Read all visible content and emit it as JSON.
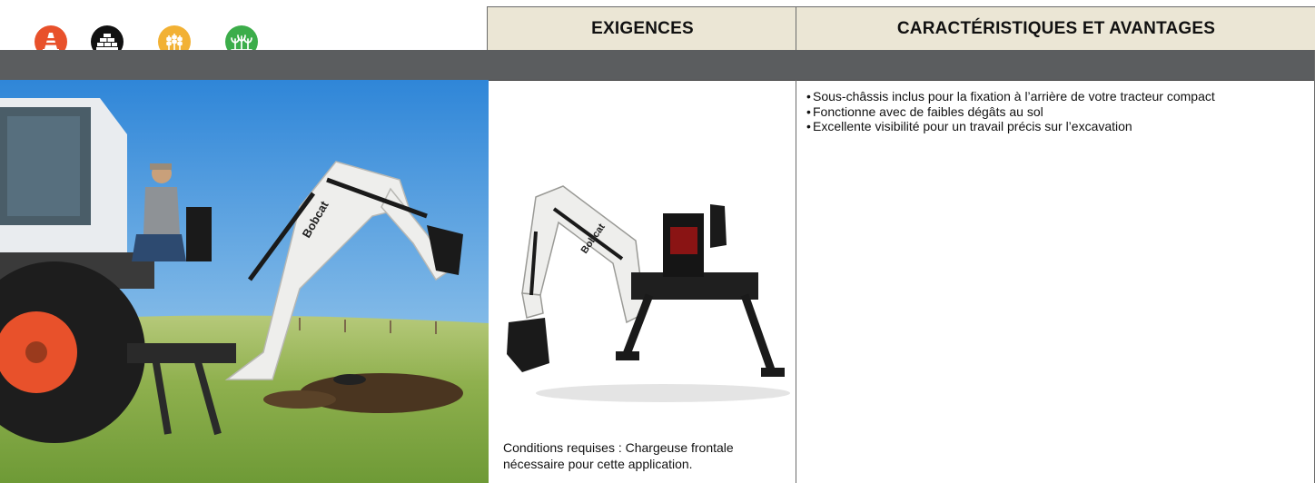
{
  "application_icons": [
    {
      "icon": "traffic-cone-icon",
      "color": "#e8512b"
    },
    {
      "icon": "brick-wall-icon",
      "color": "#111111"
    },
    {
      "icon": "wheat-icon",
      "color": "#f2b134"
    },
    {
      "icon": "plants-icon",
      "color": "#3cad4a"
    }
  ],
  "header": {
    "requirements_title": "EXIGENCES",
    "features_title": "CARACTÉRISTIQUES ET AVANTAGES"
  },
  "requirements": {
    "text": "Conditions requises : Chargeuse frontale nécessaire pour cette application."
  },
  "features": {
    "bullet": "•",
    "items": [
      "Sous-châssis inclus pour la fixation à l’arrière de votre tracteur compact",
      "Fonctionne avec de faibles dégâts au sol",
      "Excellente visibilité pour un travail précis sur l’excavation"
    ]
  },
  "brand": {
    "logo_text": "Bobcat"
  },
  "colors": {
    "header_bg": "#ebe6d5",
    "band": "#5b5d5f",
    "machine_white": "#eeeeec",
    "tractor_orange": "#e8512b"
  }
}
